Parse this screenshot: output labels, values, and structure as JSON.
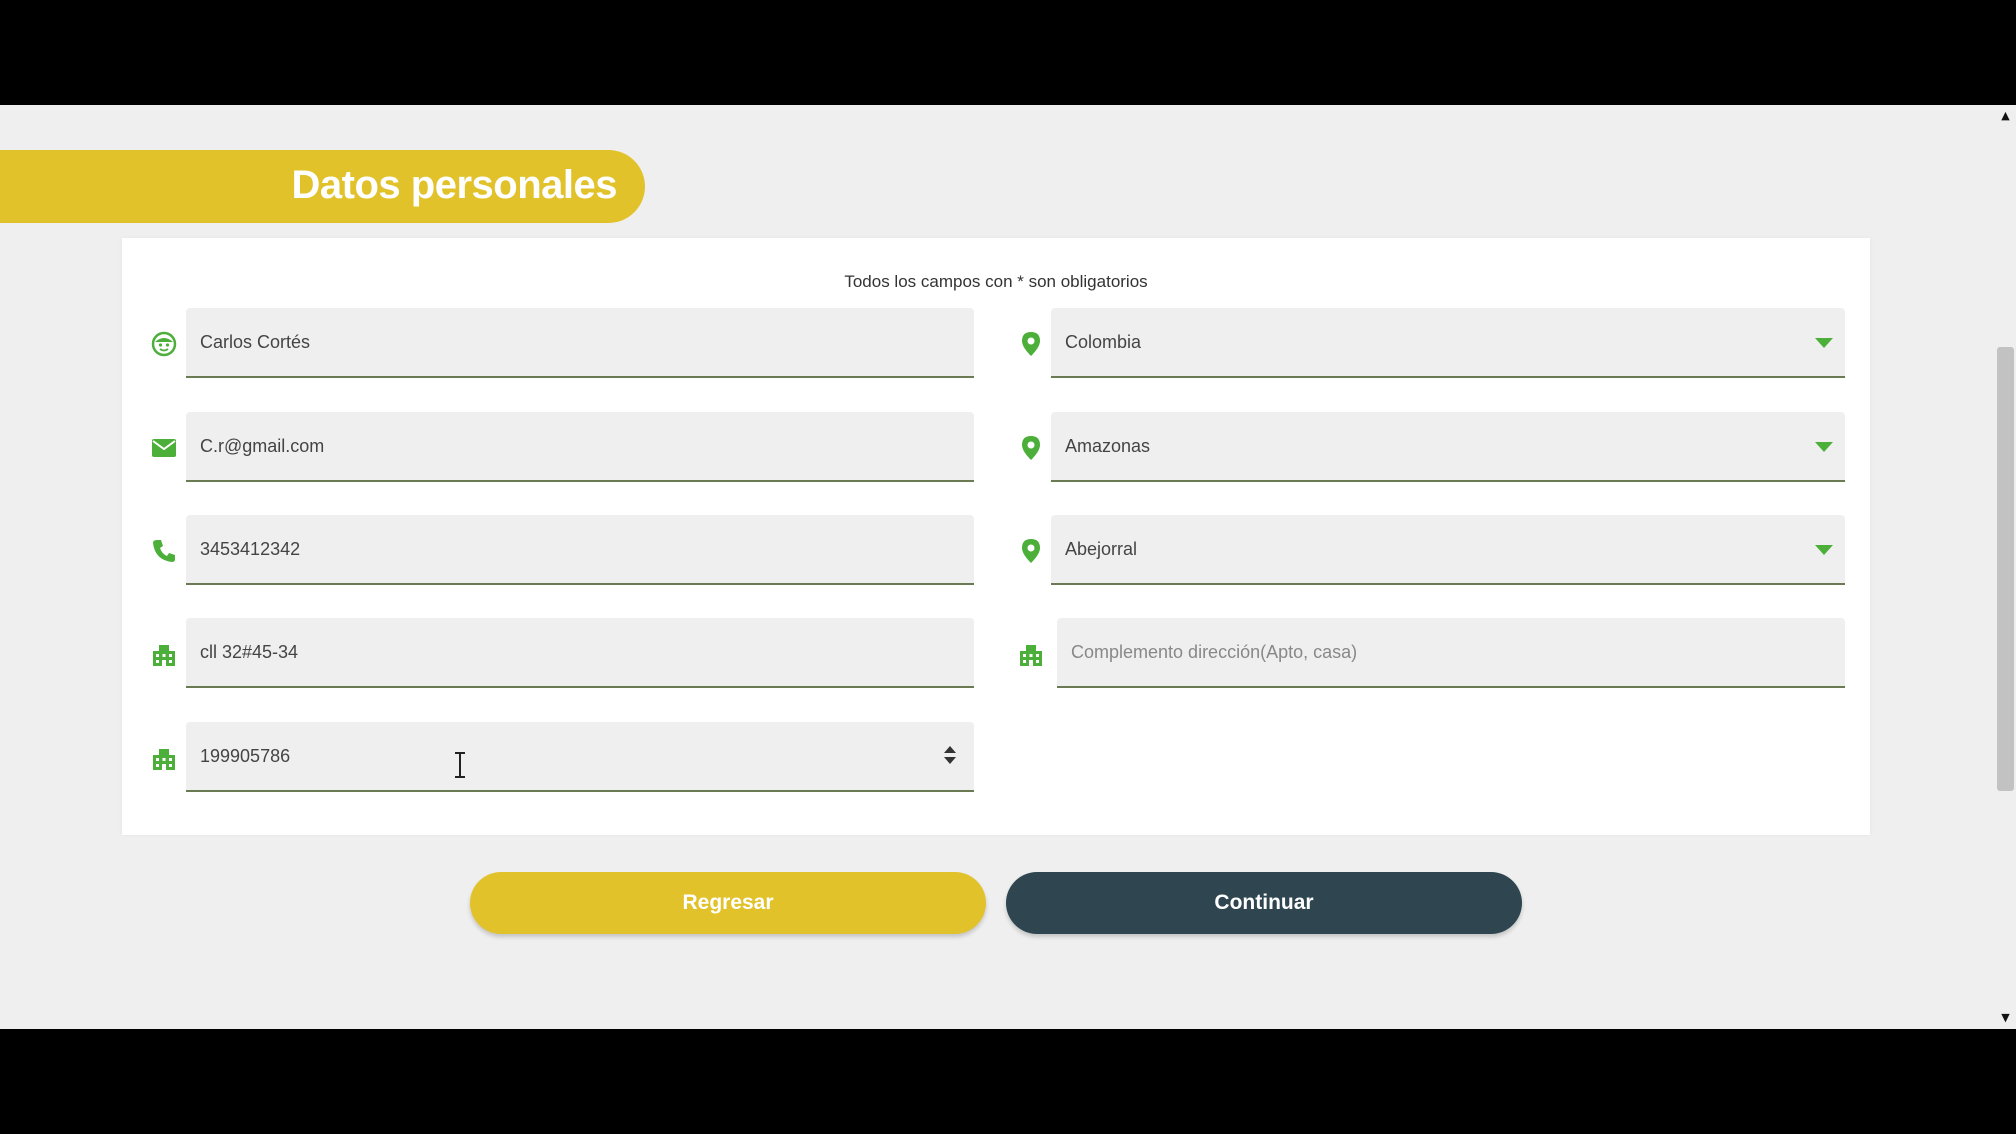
{
  "header": {
    "title": "Datos personales"
  },
  "form": {
    "required_note": "Todos los campos con * son obligatorios",
    "name_value": "Carlos Cortés",
    "email_value": "C.r@gmail.com",
    "phone_value": "3453412342",
    "address_value": "cll 32#45-34",
    "document_value": "199905786",
    "country_value": "Colombia",
    "department_value": "Amazonas",
    "city_value": "Abejorral",
    "address_complement_placeholder": "Complemento dirección(Apto, casa)"
  },
  "buttons": {
    "back_label": "Regresar",
    "continue_label": "Continuar"
  },
  "colors": {
    "accent_yellow": "#e2c22a",
    "dark_button": "#2f4650",
    "icon_green": "#4caf3a"
  }
}
